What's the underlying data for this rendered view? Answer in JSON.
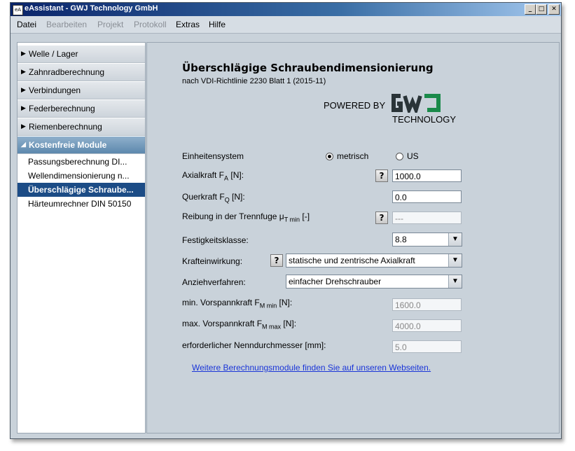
{
  "window": {
    "title": "eAssistant - GWJ Technology GmbH",
    "icon_text": "eA",
    "buttons": {
      "minimize": "_",
      "maximize": "□",
      "close": "✕"
    }
  },
  "menubar": {
    "items": [
      {
        "label": "Datei",
        "enabled": true
      },
      {
        "label": "Bearbeiten",
        "enabled": false
      },
      {
        "label": "Projekt",
        "enabled": false
      },
      {
        "label": "Protokoll",
        "enabled": false
      },
      {
        "label": "Extras",
        "enabled": true
      },
      {
        "label": "Hilfe",
        "enabled": true
      }
    ]
  },
  "sidebar": {
    "categories": [
      {
        "label": "Welle / Lager",
        "icon": "triangle-right-icon"
      },
      {
        "label": "Zahnradberechnung",
        "icon": "triangle-right-icon"
      },
      {
        "label": "Verbindungen",
        "icon": "triangle-right-icon"
      },
      {
        "label": "Federberechnung",
        "icon": "triangle-right-icon"
      },
      {
        "label": "Riemenberechnung",
        "icon": "triangle-right-icon"
      },
      {
        "label": "Kostenfreie Module",
        "icon": "triangle-down-icon"
      }
    ],
    "subitems": [
      {
        "label": "Passungsberechnung DI..."
      },
      {
        "label": "Wellendimensionierung n..."
      },
      {
        "label": "Überschlägige Schraube..."
      },
      {
        "label": "Härteumrechner DIN 50150"
      }
    ]
  },
  "main": {
    "title": "Überschlägige Schraubendimensionierung",
    "subtitle": "nach VDI-Richtlinie 2230 Blatt 1 (2015-11)",
    "powered_by": "POWERED BY",
    "logo_text": "GWJ",
    "logo_sub": "TECHNOLOGY",
    "units": {
      "label": "Einheitensystem",
      "option_metric": "metrisch",
      "option_us": "US",
      "selected": "metrisch"
    },
    "fields": {
      "axialkraft": {
        "label": "Axialkraft F",
        "sub": "A",
        "unit": " [N]:",
        "value": "1000.0"
      },
      "querkraft": {
        "label": "Querkraft F",
        "sub": "Q",
        "unit": " [N]:",
        "value": "0.0"
      },
      "reibung": {
        "label": "Reibung in der Trennfuge μ",
        "sub": "T min",
        "unit": " [-]",
        "value": "---"
      },
      "festigkeit": {
        "label": "Festigkeitsklasse:",
        "value": "8.8"
      },
      "krafteinwirkung": {
        "label": "Krafteinwirkung:",
        "value": "statische und zentrische Axialkraft"
      },
      "anziehverfahren": {
        "label": "Anziehverfahren:",
        "value": "einfacher Drehschrauber"
      },
      "min_vorspann": {
        "label": "min. Vorspannkraft F",
        "sub": "M min",
        "unit": " [N]:",
        "value": "1600.0"
      },
      "max_vorspann": {
        "label": "max. Vorspannkraft F",
        "sub": "M max",
        "unit": " [N]:",
        "value": "4000.0"
      },
      "nenndurchmesser": {
        "label": "erforderlicher Nenndurchmesser [mm]:",
        "value": "5.0"
      }
    },
    "help_symbol": "?",
    "dropdown_symbol": "▼",
    "link_text": "Weitere Berechnungsmodule finden Sie auf unseren Webseiten."
  },
  "colors": {
    "accent": "#1c4c86",
    "logo_dark": "#2a3438",
    "logo_green": "#1a8a4a",
    "link": "#1a35d8"
  }
}
